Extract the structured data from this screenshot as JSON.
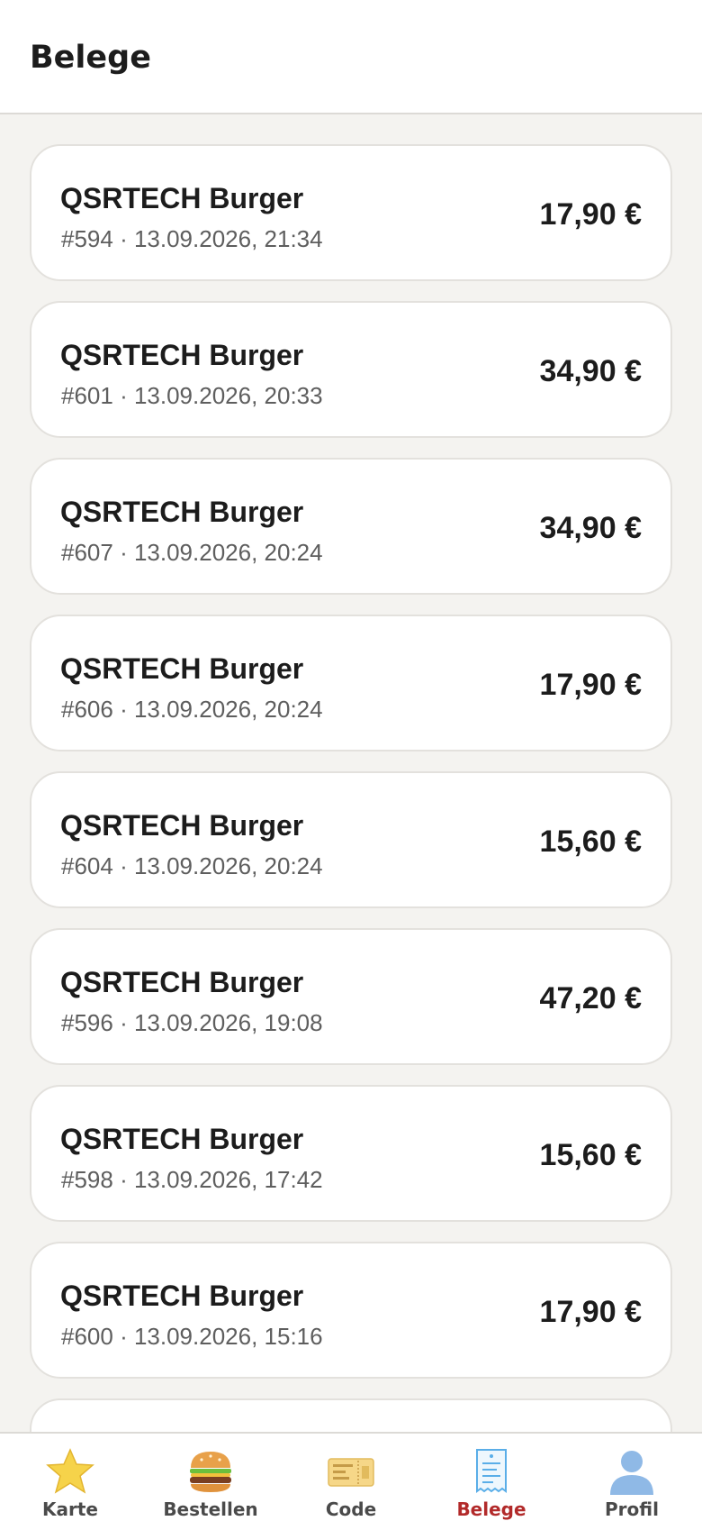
{
  "header": {
    "title": "Belege"
  },
  "receipts": [
    {
      "title": "QSRTECH Burger",
      "meta": "#594 · 13.09.2026, 21:34",
      "amount": "17,90 €"
    },
    {
      "title": "QSRTECH Burger",
      "meta": "#601 · 13.09.2026, 20:33",
      "amount": "34,90 €"
    },
    {
      "title": "QSRTECH Burger",
      "meta": "#607 · 13.09.2026, 20:24",
      "amount": "34,90 €"
    },
    {
      "title": "QSRTECH Burger",
      "meta": "#606 · 13.09.2026, 20:24",
      "amount": "17,90 €"
    },
    {
      "title": "QSRTECH Burger",
      "meta": "#604 · 13.09.2026, 20:24",
      "amount": "15,60 €"
    },
    {
      "title": "QSRTECH Burger",
      "meta": "#596 · 13.09.2026, 19:08",
      "amount": "47,20 €"
    },
    {
      "title": "QSRTECH Burger",
      "meta": "#598 · 13.09.2026, 17:42",
      "amount": "15,60 €"
    },
    {
      "title": "QSRTECH Burger",
      "meta": "#600 · 13.09.2026, 15:16",
      "amount": "17,90 €"
    },
    {
      "title": "",
      "meta": "",
      "amount": ""
    }
  ],
  "tabs": [
    {
      "label": "Karte",
      "icon": "star-icon"
    },
    {
      "label": "Bestellen",
      "icon": "burger-icon"
    },
    {
      "label": "Code",
      "icon": "ticket-icon"
    },
    {
      "label": "Belege",
      "icon": "receipt-icon",
      "active": true
    },
    {
      "label": "Profil",
      "icon": "person-icon"
    }
  ],
  "colors": {
    "active_tab": "#b22a2a",
    "background": "#f4f3f0",
    "card": "#ffffff"
  }
}
